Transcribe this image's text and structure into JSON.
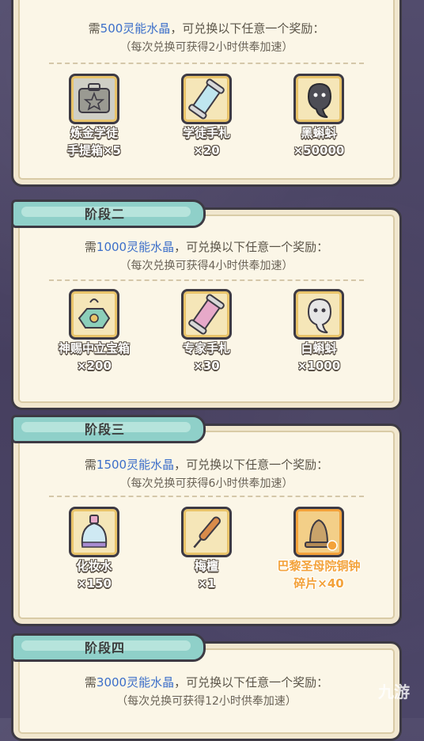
{
  "stages": [
    {
      "title": "",
      "requirement_prefix": "需",
      "requirement_amount": "500灵能水晶",
      "requirement_suffix": "，可兑换以下任意一个奖励：",
      "note": "（每次兑换可获得2小时供奉加速）",
      "rewards": [
        {
          "name": "炼金学徒",
          "qty": "手提箱×5",
          "icon": "briefcase-icon"
        },
        {
          "name": "学徒手札",
          "qty": "×20",
          "icon": "scroll-icon"
        },
        {
          "name": "黑蝌蚪",
          "qty": "×50000",
          "icon": "black-tadpole-icon"
        }
      ]
    },
    {
      "title": "阶段二",
      "requirement_prefix": "需",
      "requirement_amount": "1000灵能水晶",
      "requirement_suffix": "，可兑换以下任意一个奖励：",
      "note": "（每次兑换可获得4小时供奉加速）",
      "rewards": [
        {
          "name": "神赐中立宝箱",
          "qty": "×200",
          "icon": "treasure-chest-icon"
        },
        {
          "name": "专家手札",
          "qty": "×30",
          "icon": "expert-scroll-icon"
        },
        {
          "name": "白蝌蚪",
          "qty": "×1000",
          "icon": "white-tadpole-icon"
        }
      ]
    },
    {
      "title": "阶段三",
      "requirement_prefix": "需",
      "requirement_amount": "1500灵能水晶",
      "requirement_suffix": "，可兑换以下任意一个奖励：",
      "note": "（每次兑换可获得6小时供奉加速）",
      "rewards": [
        {
          "name": "化妆水",
          "qty": "×150",
          "icon": "perfume-bottle-icon"
        },
        {
          "name": "梅檀",
          "qty": "×1",
          "icon": "incense-stick-icon"
        },
        {
          "name": "巴黎圣母院铜钟",
          "qty": "碎片×40",
          "icon": "bell-fragment-icon"
        }
      ]
    },
    {
      "title": "阶段四",
      "requirement_prefix": "需",
      "requirement_amount": "3000灵能水晶",
      "requirement_suffix": "，可兑换以下任意一个奖励：",
      "note": "（每次兑换可获得12小时供奉加速）",
      "rewards": []
    }
  ],
  "watermark": "九游",
  "colors": {
    "accent_blue": "#3c6fc9",
    "tab_teal": "#8fd0c9",
    "card_bg": "#fbf6e7",
    "highlight_orange": "#f3a23a"
  }
}
